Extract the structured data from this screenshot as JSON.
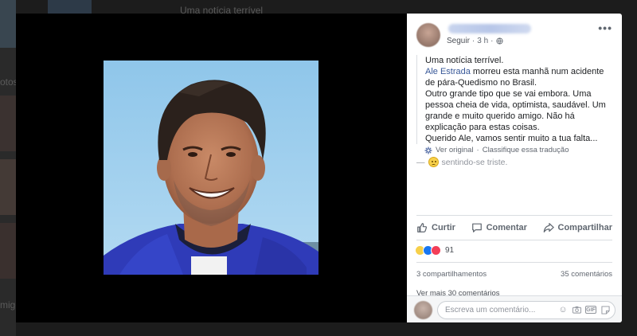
{
  "background": {
    "top_text": "Uma notícia terrível",
    "left_text_1": "otos",
    "left_text_2": "migo"
  },
  "post": {
    "follow_label": "Seguir",
    "time": "3 h",
    "more_label": "•••",
    "lines": [
      "Uma notícia terrível."
    ],
    "mention": "Ale Estrada",
    "body_after_mention": " morreu esta manhã num acidente de pára-Quedismo no Brasil.",
    "line_3": "Outro grande tipo que se vai embora. Uma pessoa cheia de vida, optimista, saudável. Um grande e muito querido amigo. Não há explicação para estas coisas.",
    "line_4": "Querido Ale, vamos sentir muito a tua falta...",
    "see_original": "Ver original",
    "classify_translation": "Classifique essa tradução",
    "feeling_prefix": "—",
    "feeling": "sentindo-se triste."
  },
  "actions": {
    "like": "Curtir",
    "comment": "Comentar",
    "share": "Compartilhar"
  },
  "reactions": {
    "count": "91",
    "types": [
      "sad",
      "like",
      "love"
    ]
  },
  "stats": {
    "shares": "3 compartilhamentos",
    "comments": "35 comentários",
    "more_comments": "Ver mais 30 comentários"
  },
  "comment_bar": {
    "placeholder": "Escreva um comentário...",
    "gif_label": "GIF"
  },
  "colors": {
    "link": "#385898",
    "like_blue": "#1877f2",
    "love_red": "#f33e58",
    "sad_yellow": "#f7d04a"
  }
}
